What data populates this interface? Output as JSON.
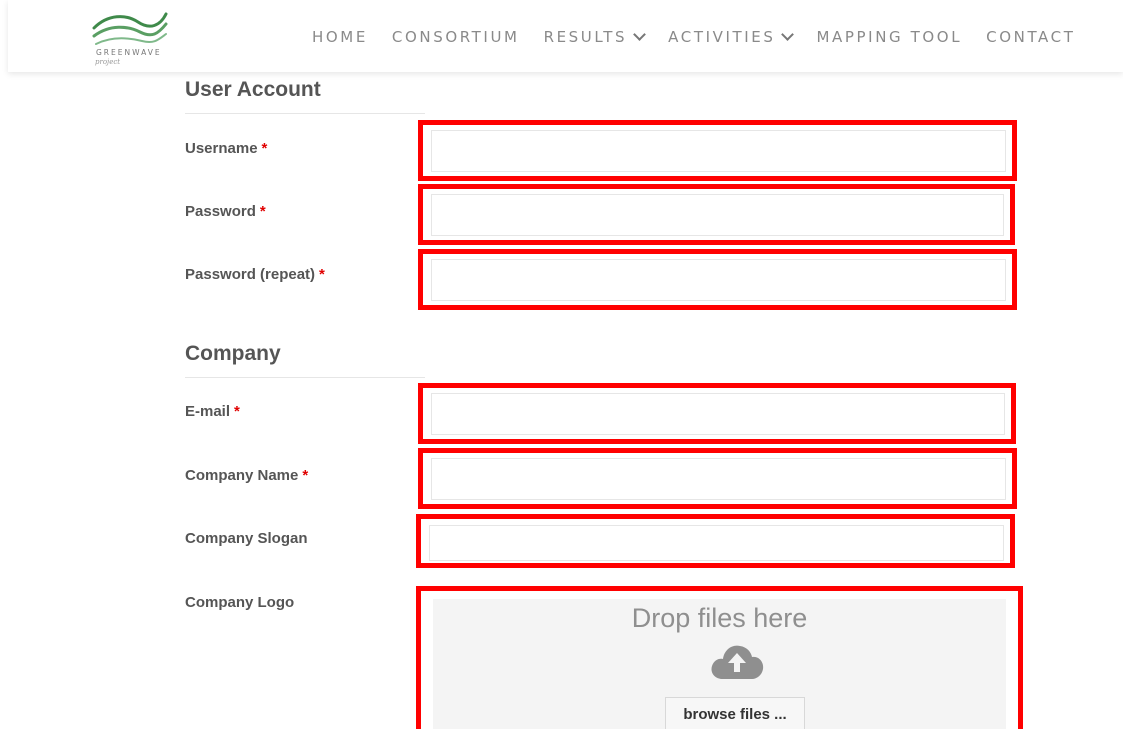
{
  "brand": {
    "name": "GREENWAVE",
    "tagline": "project",
    "colors": {
      "wave_dark": "#3f8a4a",
      "wave_light": "#7fb98a"
    }
  },
  "nav": {
    "items": [
      {
        "label": "HOME",
        "has_dropdown": false
      },
      {
        "label": "CONSORTIUM",
        "has_dropdown": false
      },
      {
        "label": "RESULTS",
        "has_dropdown": true
      },
      {
        "label": "ACTIVITIES",
        "has_dropdown": true
      },
      {
        "label": "MAPPING TOOL",
        "has_dropdown": false
      },
      {
        "label": "CONTACT",
        "has_dropdown": false
      }
    ]
  },
  "form": {
    "user_account": {
      "title": "User Account",
      "fields": {
        "username": {
          "label": "Username",
          "required_mark": "*",
          "value": ""
        },
        "password": {
          "label": "Password",
          "required_mark": "*",
          "value": ""
        },
        "password_repeat": {
          "label": "Password (repeat)",
          "required_mark": "*",
          "value": ""
        }
      }
    },
    "company": {
      "title": "Company",
      "fields": {
        "email": {
          "label": "E-mail",
          "required_mark": "*",
          "value": ""
        },
        "company_name": {
          "label": "Company Name",
          "required_mark": "*",
          "value": ""
        },
        "company_slogan": {
          "label": "Company Slogan",
          "value": ""
        },
        "company_logo": {
          "label": "Company Logo",
          "drop_text": "Drop files here",
          "upload_icon": "cloud-upload-icon",
          "browse_label": "browse files ..."
        }
      }
    }
  },
  "colors": {
    "highlight_border": "#ff0000",
    "required_star": "#e00000",
    "text": "#555555",
    "nav_text": "#8a8a8a"
  }
}
